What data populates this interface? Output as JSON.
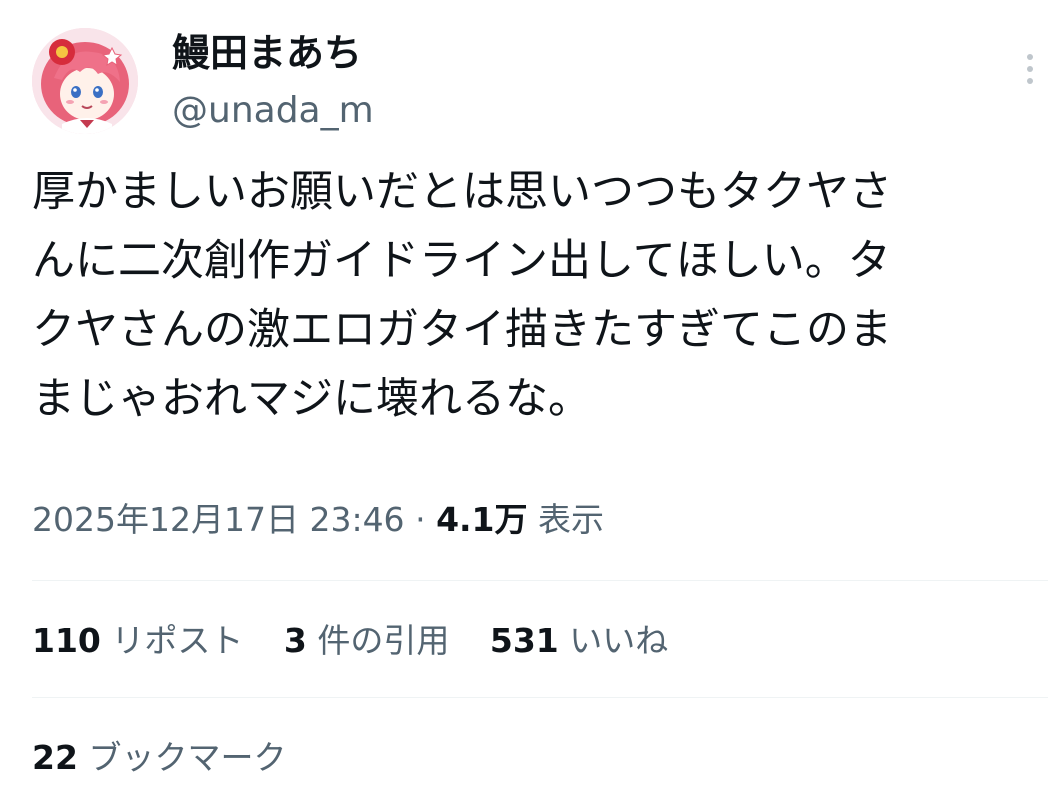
{
  "author": {
    "display_name": "鰻田まあち",
    "handle": "@unada_m"
  },
  "tweet": {
    "lines": [
      "厚かましいお願いだとは思いつつもタクヤさ",
      "んに二次創作ガイドライン出してほしい。タ",
      "クヤさんの激エロガタイ描きたすぎてこのま",
      "まじゃおれマジに壊れるな。"
    ]
  },
  "meta": {
    "timestamp": "2025年12月17日 23:46",
    "separator": "·",
    "views_count": "4.1万",
    "views_label": "表示"
  },
  "stats": {
    "reposts": {
      "count": "110",
      "label": "リポスト"
    },
    "quotes": {
      "count": "3",
      "label": "件の引用"
    },
    "likes": {
      "count": "531",
      "label": "いいね"
    },
    "bookmarks": {
      "count": "22",
      "label": "ブックマーク"
    }
  },
  "icons": {
    "more": "more-vertical-icon",
    "avatar": "anime-avatar"
  },
  "colors": {
    "text_primary": "#0f1419",
    "text_secondary": "#536471",
    "divider": "#eff3f4"
  }
}
